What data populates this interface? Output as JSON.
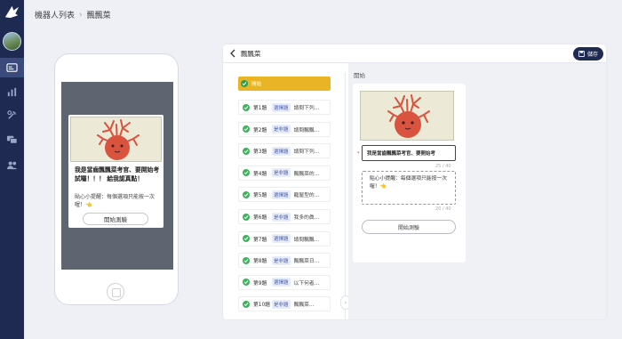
{
  "breadcrumb": {
    "parent": "機器人列表",
    "separator": "›",
    "current": "飄飄菜"
  },
  "phone": {
    "title": "我是當齒飄飄菜考官、要開始考試囉！！！ 給我認真點！",
    "description": "貼心小提醒：每個選項只能按一次喔！👈",
    "start_button": "開始測驗"
  },
  "panel": {
    "back_title": "飄飄菜",
    "save_label": "儲存",
    "start_item_label": "開始",
    "questions": [
      {
        "num": "第1題",
        "type": "選擇題",
        "text": "請問下列..."
      },
      {
        "num": "第2題",
        "type": "是非題",
        "text": "請問飄飄..."
      },
      {
        "num": "第3題",
        "type": "選擇題",
        "text": "請問下列..."
      },
      {
        "num": "第4題",
        "type": "是非題",
        "text": "飄飄菜的..."
      },
      {
        "num": "第5題",
        "type": "選擇題",
        "text": "寵屋型的..."
      },
      {
        "num": "第6題",
        "type": "是非題",
        "text": "我多的眞..."
      },
      {
        "num": "第7題",
        "type": "選擇題",
        "text": "請問飄飄..."
      },
      {
        "num": "第8題",
        "type": "是非題",
        "text": "飄飄菜日..."
      },
      {
        "num": "第9題",
        "type": "選擇題",
        "text": "以下何者..."
      },
      {
        "num": "第10題",
        "type": "是非題",
        "text": "飄飄菜..."
      }
    ],
    "editor": {
      "section_label": "開始",
      "title_value": "我是當齒飄飄菜考官、要開始考",
      "required_mark": "*",
      "title_count": "25 / 40",
      "description_value": "貼心小提醒：每個選項只能按一次喔！👈",
      "description_count": "20 / 40",
      "start_button": "開始測驗"
    },
    "collapse_glyph": "›"
  },
  "colors": {
    "sidebar": "#1f2a52",
    "accent": "#e9b526",
    "success": "#3db25b"
  }
}
